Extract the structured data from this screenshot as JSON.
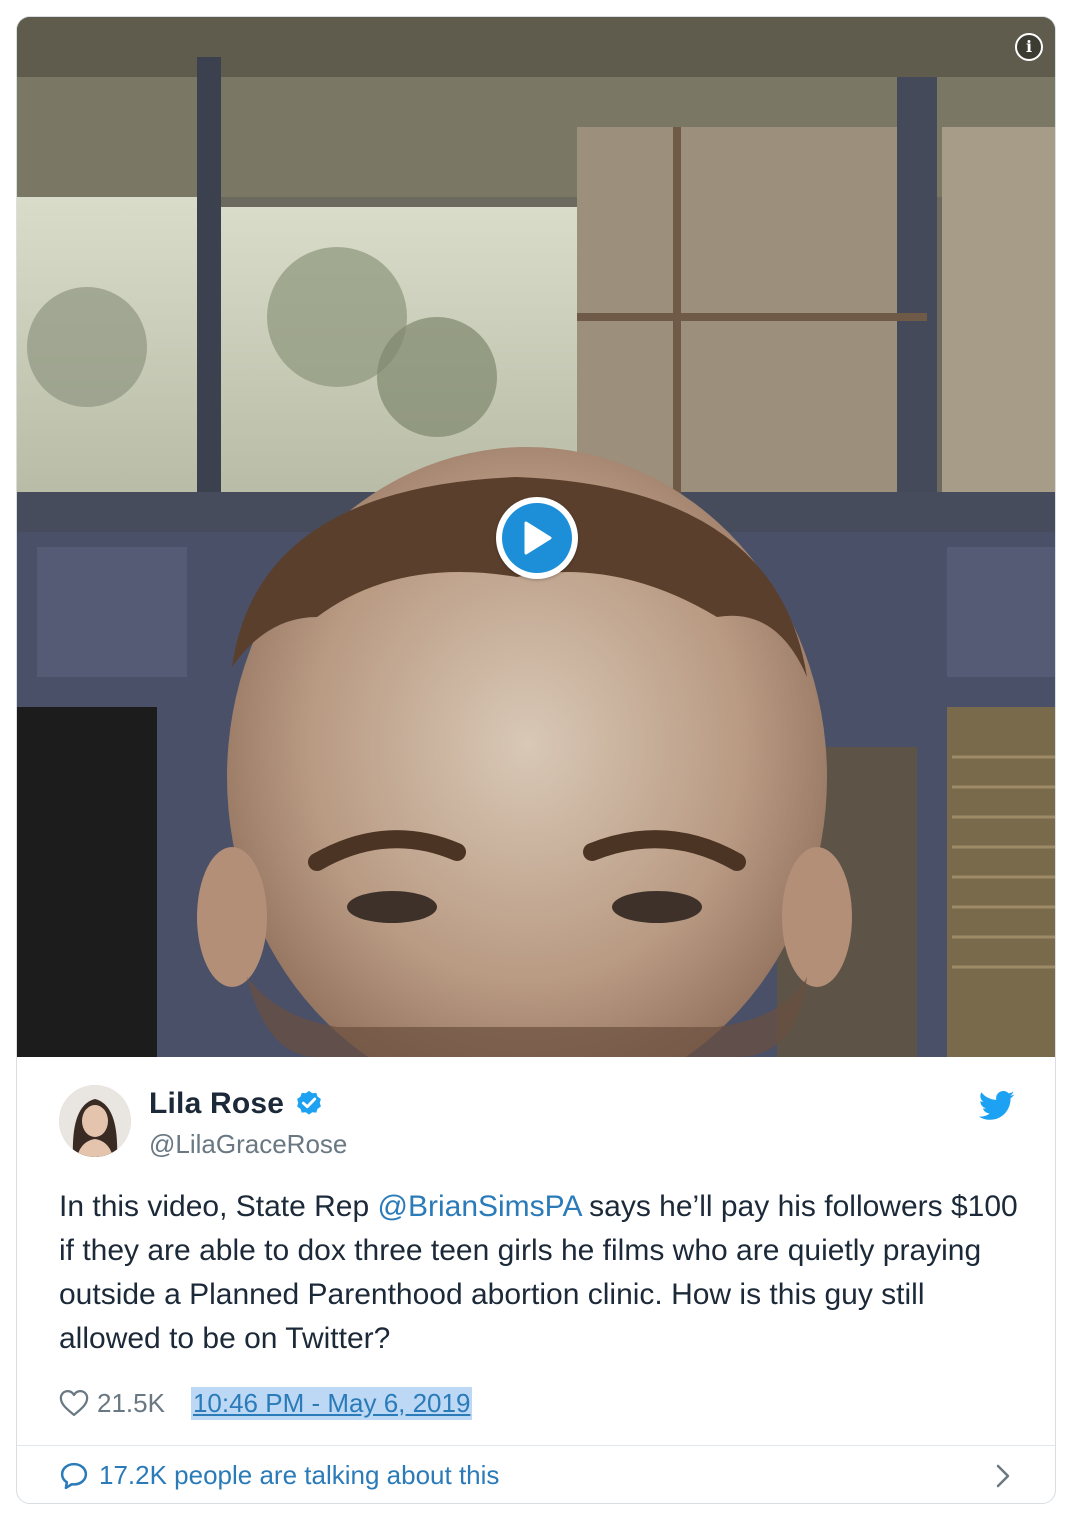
{
  "video": {
    "info_icon": "info-icon",
    "play_icon": "play-icon"
  },
  "tweet": {
    "display_name": "Lila Rose",
    "handle": "@LilaGraceRose",
    "verified_icon": "verified-badge-icon",
    "platform_icon": "twitter-bird-icon",
    "text_before_mention": "In this video, State Rep ",
    "mention": "@BrianSimsPA",
    "text_after_mention": " says he’ll pay his followers $100 if they are able to dox three teen girls he films who are quietly praying outside a Planned Parenthood abortion clinic. How is this guy still allowed to be on Twitter?",
    "like_count": "21.5K",
    "timestamp": "10:46 PM - May 6, 2019",
    "talking_text": "17.2K people are talking about this"
  },
  "colors": {
    "link": "#2b7bb9",
    "twitter_blue": "#1da1f2",
    "play_blue": "#1d8fd8",
    "secondary_text": "#697882",
    "timestamp_highlight": "#bcd8f5"
  }
}
